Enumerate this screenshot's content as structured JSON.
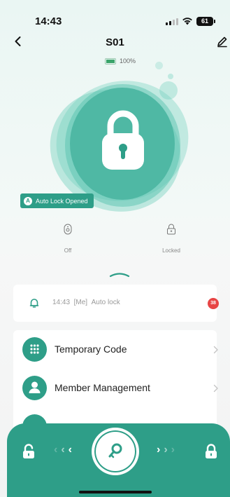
{
  "status_bar": {
    "time": "14:43",
    "battery_level": "61"
  },
  "header": {
    "title": "S01"
  },
  "battery": {
    "label": "100%",
    "level": 1.0
  },
  "lock_badge": {
    "icon_letter": "A",
    "label": "Auto Lock Opened"
  },
  "modes": [
    {
      "icon": "doorbell-icon",
      "label": "Off"
    },
    {
      "icon": "lock-status-icon",
      "label": "Locked"
    }
  ],
  "log": {
    "time": "14:43",
    "user": "[Me]",
    "action": "Auto lock",
    "unread_count": "38"
  },
  "menu": [
    {
      "icon": "keypad-icon",
      "label": "Temporary Code"
    },
    {
      "icon": "member-icon",
      "label": "Member Management"
    }
  ],
  "colors": {
    "accent": "#2e9e88",
    "lock_blob": "#4fb8a4",
    "alert": "#e74545"
  }
}
